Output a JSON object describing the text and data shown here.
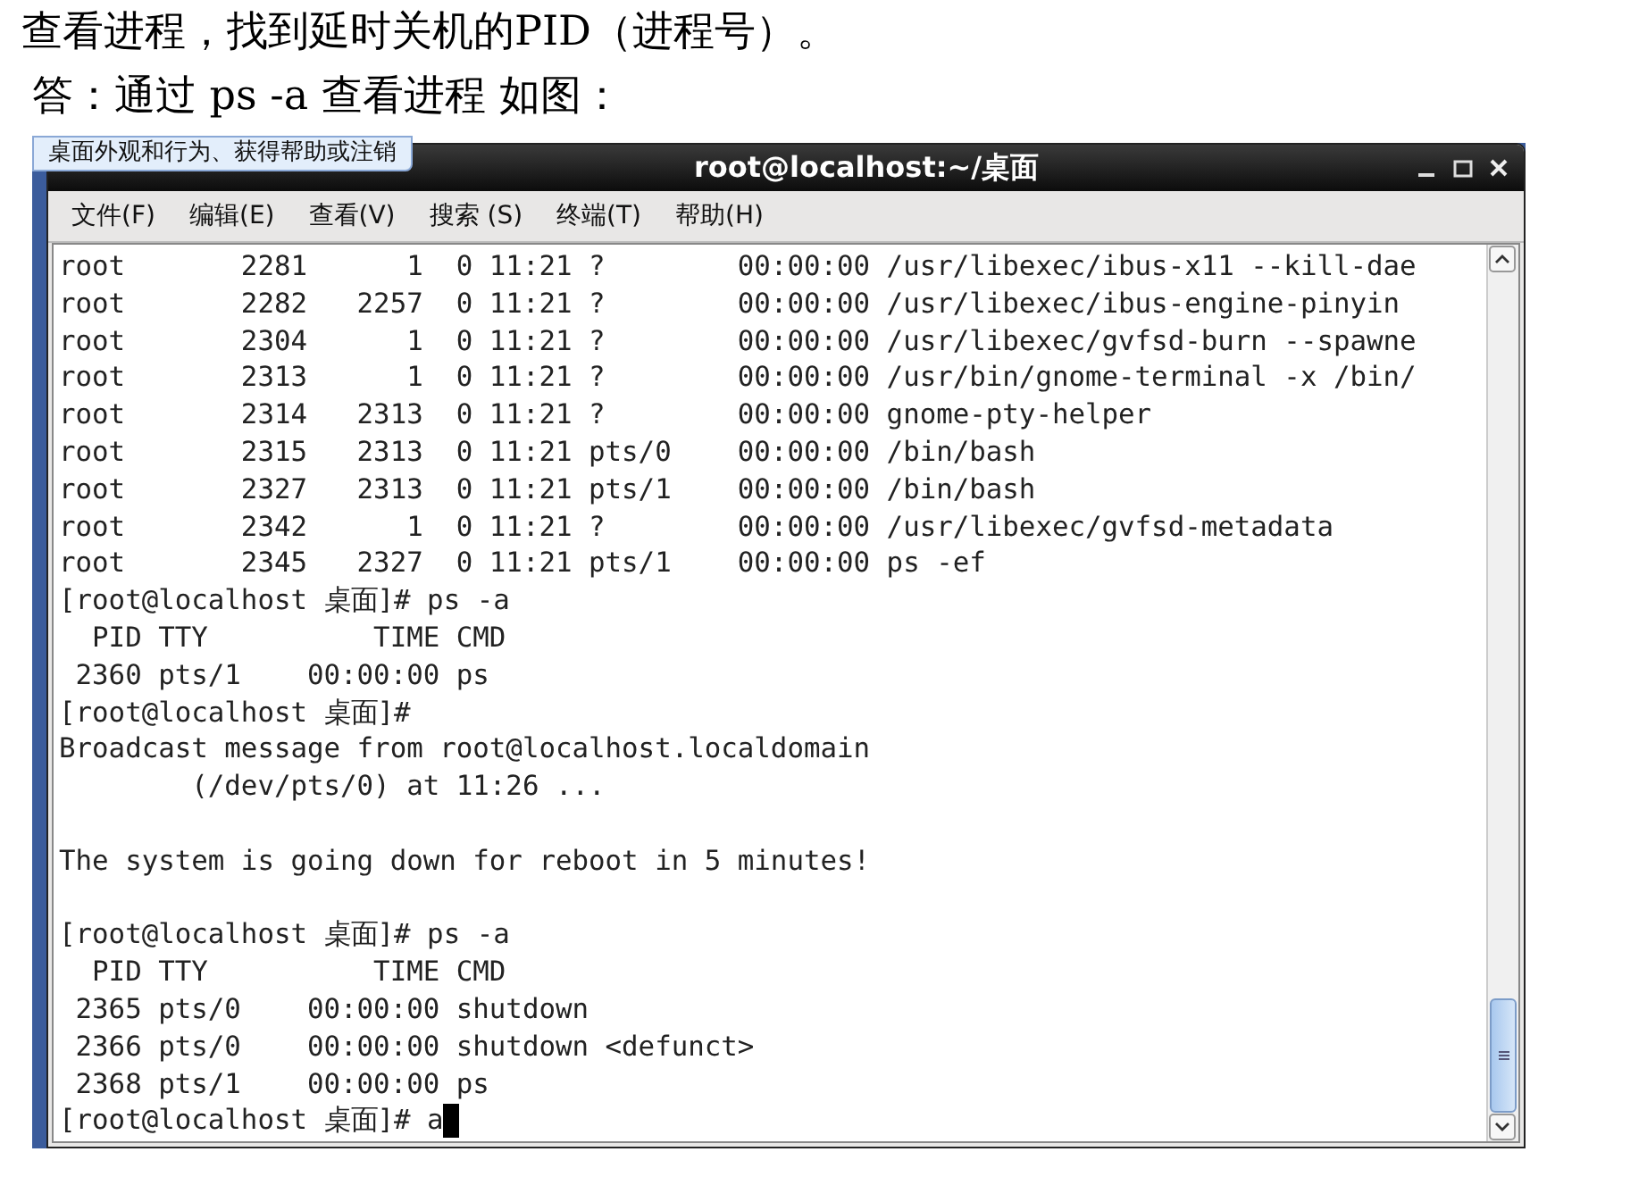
{
  "document": {
    "question": "查看进程，找到延时关机的PID（进程号）。",
    "answer": "答：通过 ps -a 查看进程 如图："
  },
  "screenshot": {
    "tooltip": "桌面外观和行为、获得帮助或注销",
    "window": {
      "title": "root@localhost:~/桌面",
      "menu": [
        "文件(F)",
        "编辑(E)",
        "查看(V)",
        "搜索 (S)",
        "终端(T)",
        "帮助(H)"
      ],
      "lines": [
        {
          "kind": "output",
          "text": "root       2281      1  0 11:21 ?        00:00:00 /usr/libexec/ibus-x11 --kill-dae"
        },
        {
          "kind": "output",
          "text": "root       2282   2257  0 11:21 ?        00:00:00 /usr/libexec/ibus-engine-pinyin"
        },
        {
          "kind": "output",
          "text": "root       2304      1  0 11:21 ?        00:00:00 /usr/libexec/gvfsd-burn --spawne"
        },
        {
          "kind": "output",
          "text": "root       2313      1  0 11:21 ?        00:00:00 /usr/bin/gnome-terminal -x /bin/"
        },
        {
          "kind": "output",
          "text": "root       2314   2313  0 11:21 ?        00:00:00 gnome-pty-helper"
        },
        {
          "kind": "output",
          "text": "root       2315   2313  0 11:21 pts/0    00:00:00 /bin/bash"
        },
        {
          "kind": "output",
          "text": "root       2327   2313  0 11:21 pts/1    00:00:00 /bin/bash"
        },
        {
          "kind": "output",
          "text": "root       2342      1  0 11:21 ?        00:00:00 /usr/libexec/gvfsd-metadata"
        },
        {
          "kind": "output",
          "text": "root       2345   2327  0 11:21 pts/1    00:00:00 ps -ef"
        },
        {
          "kind": "output",
          "text": "[root@localhost 桌面]# ps -a"
        },
        {
          "kind": "output",
          "text": "  PID TTY          TIME CMD"
        },
        {
          "kind": "output",
          "text": " 2360 pts/1    00:00:00 ps"
        },
        {
          "kind": "output",
          "text": "[root@localhost 桌面]#"
        },
        {
          "kind": "output",
          "text": "Broadcast message from root@localhost.localdomain"
        },
        {
          "kind": "output",
          "text": "        (/dev/pts/0) at 11:26 ..."
        },
        {
          "kind": "blank"
        },
        {
          "kind": "output",
          "text": "The system is going down for reboot in 5 minutes!"
        },
        {
          "kind": "blank"
        },
        {
          "kind": "output",
          "text": "[root@localhost 桌面]# ps -a"
        },
        {
          "kind": "output",
          "text": "  PID TTY          TIME CMD"
        },
        {
          "kind": "output",
          "text": " 2365 pts/0    00:00:00 shutdown"
        },
        {
          "kind": "output",
          "text": " 2366 pts/0    00:00:00 shutdown <defunct>"
        },
        {
          "kind": "output",
          "text": " 2368 pts/1    00:00:00 ps"
        },
        {
          "kind": "input",
          "text": "[root@localhost 桌面]# a"
        }
      ]
    }
  }
}
